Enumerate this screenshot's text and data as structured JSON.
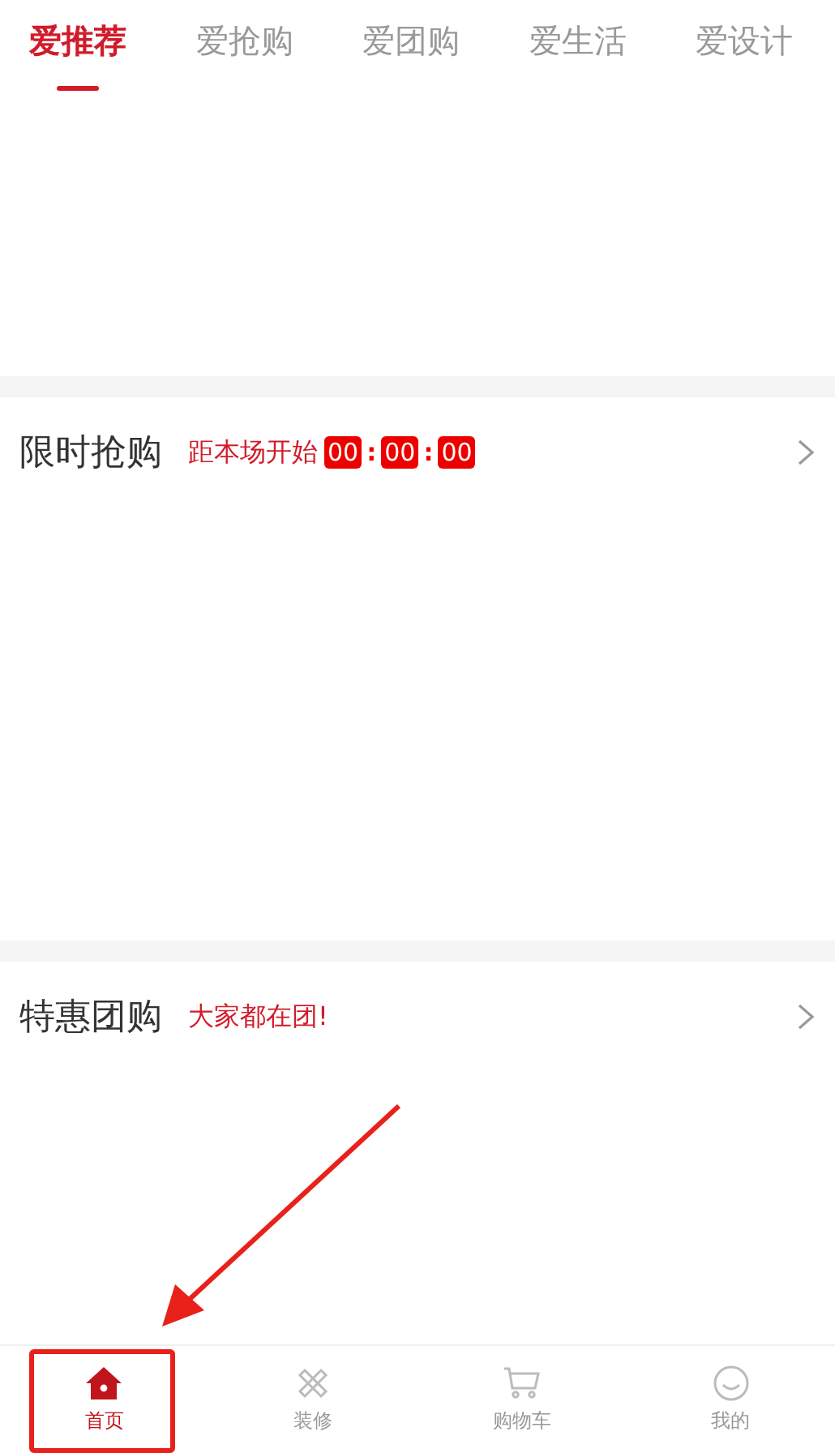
{
  "tabs": [
    {
      "label": "爱推荐",
      "selected": true
    },
    {
      "label": "爱抢购",
      "selected": false
    },
    {
      "label": "爱团购",
      "selected": false
    },
    {
      "label": "爱生活",
      "selected": false
    },
    {
      "label": "爱设计",
      "selected": false
    }
  ],
  "sections": [
    {
      "title": "限时抢购",
      "note": "距本场开始",
      "countdown": [
        {
          "kind": "digits",
          "text": "00"
        },
        {
          "kind": "separator",
          "text": ":"
        },
        {
          "kind": "digits",
          "text": "00"
        },
        {
          "kind": "separator",
          "text": ":"
        },
        {
          "kind": "digits",
          "text": "00"
        }
      ]
    },
    {
      "title": "特惠团购",
      "note": "大家都在团!"
    }
  ],
  "bottom_nav": [
    {
      "label": "首页",
      "kind": "home",
      "selected": true
    },
    {
      "label": "装修",
      "kind": "tools",
      "selected": false
    },
    {
      "label": "购物车",
      "kind": "cart",
      "selected": false
    },
    {
      "label": "我的",
      "kind": "user",
      "selected": false
    }
  ],
  "annotation": {
    "highlight": true,
    "arrow": true
  }
}
